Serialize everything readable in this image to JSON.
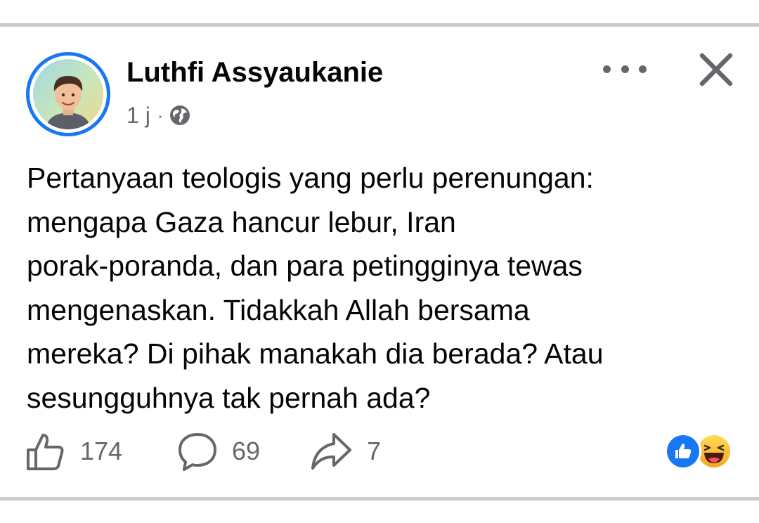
{
  "post": {
    "author": "Luthfi Assyaukanie",
    "time": "1 j",
    "separator": "·",
    "visibility_icon": "globe-icon",
    "text": "Pertanyaan teologis yang perlu perenungan:\nmengapa Gaza hancur lebur, Iran\nporak-poranda, dan para petingginya tewas\nmengenaskan. Tidakkah Allah bersama\nmereka? Di pihak manakah dia berada? Atau\nsesungguhnya tak pernah ada?"
  },
  "header_actions": {
    "more_icon": "more-dots-icon",
    "close_icon": "close-icon"
  },
  "actions": {
    "like_count": "174",
    "comment_count": "69",
    "share_count": "7"
  },
  "reactions": [
    "like",
    "haha"
  ],
  "colors": {
    "accent": "#1877f2",
    "secondary_text": "#65676b",
    "divider": "#c9ccd1"
  }
}
